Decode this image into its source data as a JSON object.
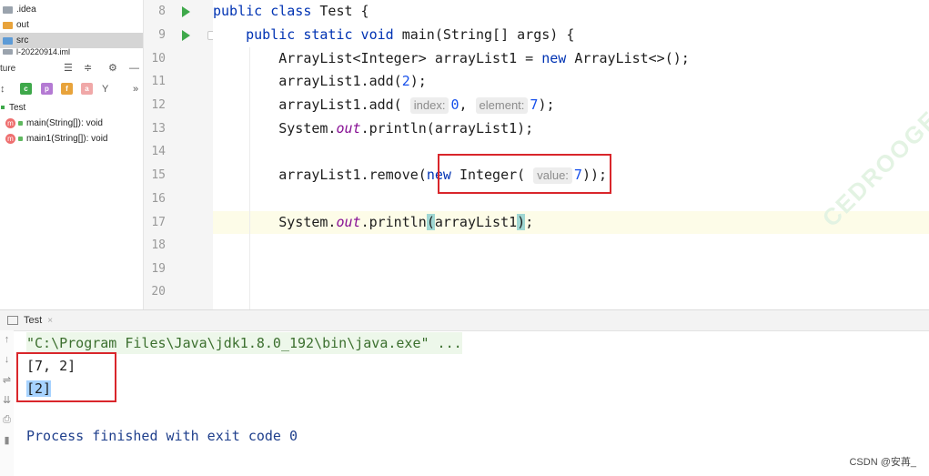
{
  "project_tree": [
    {
      "label": ".idea",
      "icon": "folder-gray-icon",
      "selected": false
    },
    {
      "label": "out",
      "icon": "folder-orange-icon",
      "selected": false
    },
    {
      "label": "src",
      "icon": "folder-blue-icon",
      "selected": true
    },
    {
      "label": "l-20220914.iml",
      "icon": "module-file-icon",
      "selected": false
    }
  ],
  "structure": {
    "title": "ture",
    "toolbar_badges": [
      "c",
      "p",
      "f",
      "a"
    ],
    "expand_label": "»",
    "root": "Test",
    "methods": [
      "main(String[]): void",
      "main1(String[]): void"
    ]
  },
  "editor": {
    "line_numbers": [
      "8",
      "9",
      "10",
      "11",
      "12",
      "13",
      "14",
      "15",
      "16",
      "17",
      "18",
      "19",
      "20"
    ],
    "code": {
      "l8_a": "public class ",
      "l8_b": "Test {",
      "l9_a": "    public static void ",
      "l9_b": "main(String[] args) {",
      "l10_a": "        ArrayList<Integer> arrayList1 = ",
      "l10_b": "new ",
      "l10_c": "ArrayList<>();",
      "l11_a": "        arrayList1.add(",
      "l11_b": "2",
      "l11_c": ");",
      "l12_a": "        arrayList1.add( ",
      "l12_hint1": "index:",
      "l12_b": "0",
      "l12_c": ", ",
      "l12_hint2": "element:",
      "l12_d": "7",
      "l12_e": ");",
      "l13_a": "        System.",
      "l13_b": "out",
      "l13_c": ".println(arrayList1);",
      "l15_a": "        arrayList1.remove(",
      "l15_b": "new ",
      "l15_c": "Integer( ",
      "l15_hint": "value:",
      "l15_d": "7",
      "l15_e": "));",
      "l17_a": "        System.",
      "l17_b": "out",
      "l17_c": ".println",
      "l17_d": "(",
      "l17_e": "arrayList1",
      "l17_f": ")",
      "l17_g": ";"
    },
    "watermark": "CEDROOGE"
  },
  "run_panel": {
    "tab_label": "Test",
    "tab_close": "×",
    "command": "\"C:\\Program Files\\Java\\jdk1.8.0_192\\bin\\java.exe\" ...",
    "output_lines": [
      "[7, 2]",
      "[2]"
    ],
    "exit_message": "Process finished with exit code 0"
  },
  "footer_mark": "CSDN @安苒_",
  "colors": {
    "keyword": "#0033b3",
    "number": "#1750eb",
    "static_field": "#871094",
    "highlight_box": "#d9262b",
    "run_icon": "#3ea84a"
  }
}
